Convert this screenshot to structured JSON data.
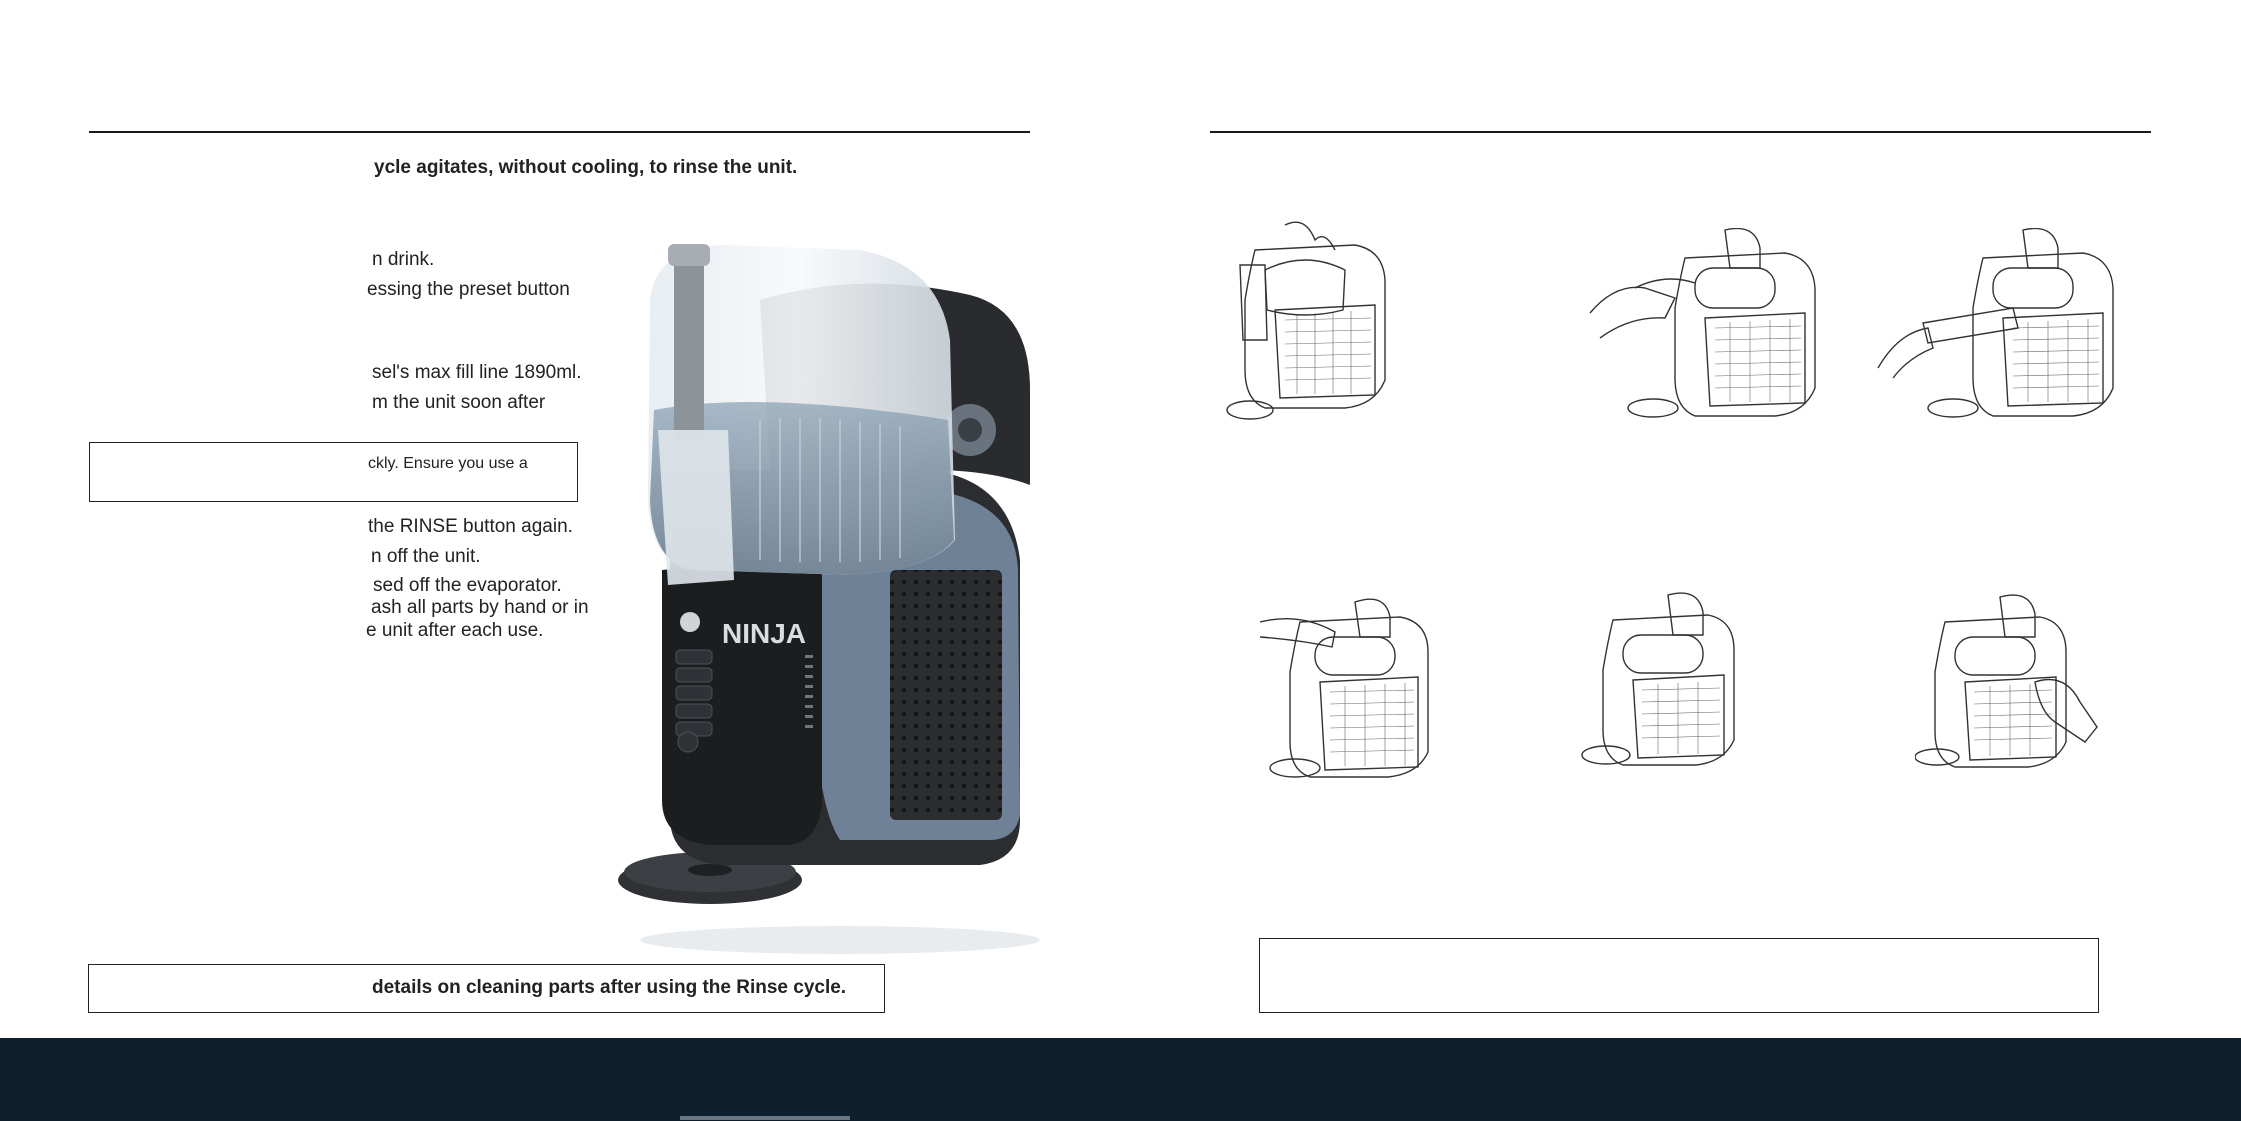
{
  "left_page": {
    "intro_bold": "ycle agitates, without cooling, to rinse the unit.",
    "lines": [
      "n drink.",
      "essing the preset button",
      "sel's max fill line 1890ml.",
      "m the unit soon after",
      "ckly. Ensure you use a",
      "the RINSE button again.",
      "n off the unit.",
      "sed off the evaporator.",
      "ash all parts by hand or in",
      "e unit after each use."
    ],
    "bottom_note": "details on cleaning parts after using the Rinse cycle.",
    "product_logo": "NINJA"
  },
  "right_page": {
    "illustrations": [
      "step-1-illustration",
      "step-2-illustration",
      "step-3-illustration",
      "step-4-illustration",
      "step-5-illustration",
      "step-6-illustration"
    ],
    "note_box": ""
  },
  "colors": {
    "footer": "#0d1e2c",
    "body_blue": "#6f8196",
    "body_dark": "#2b2d30"
  }
}
